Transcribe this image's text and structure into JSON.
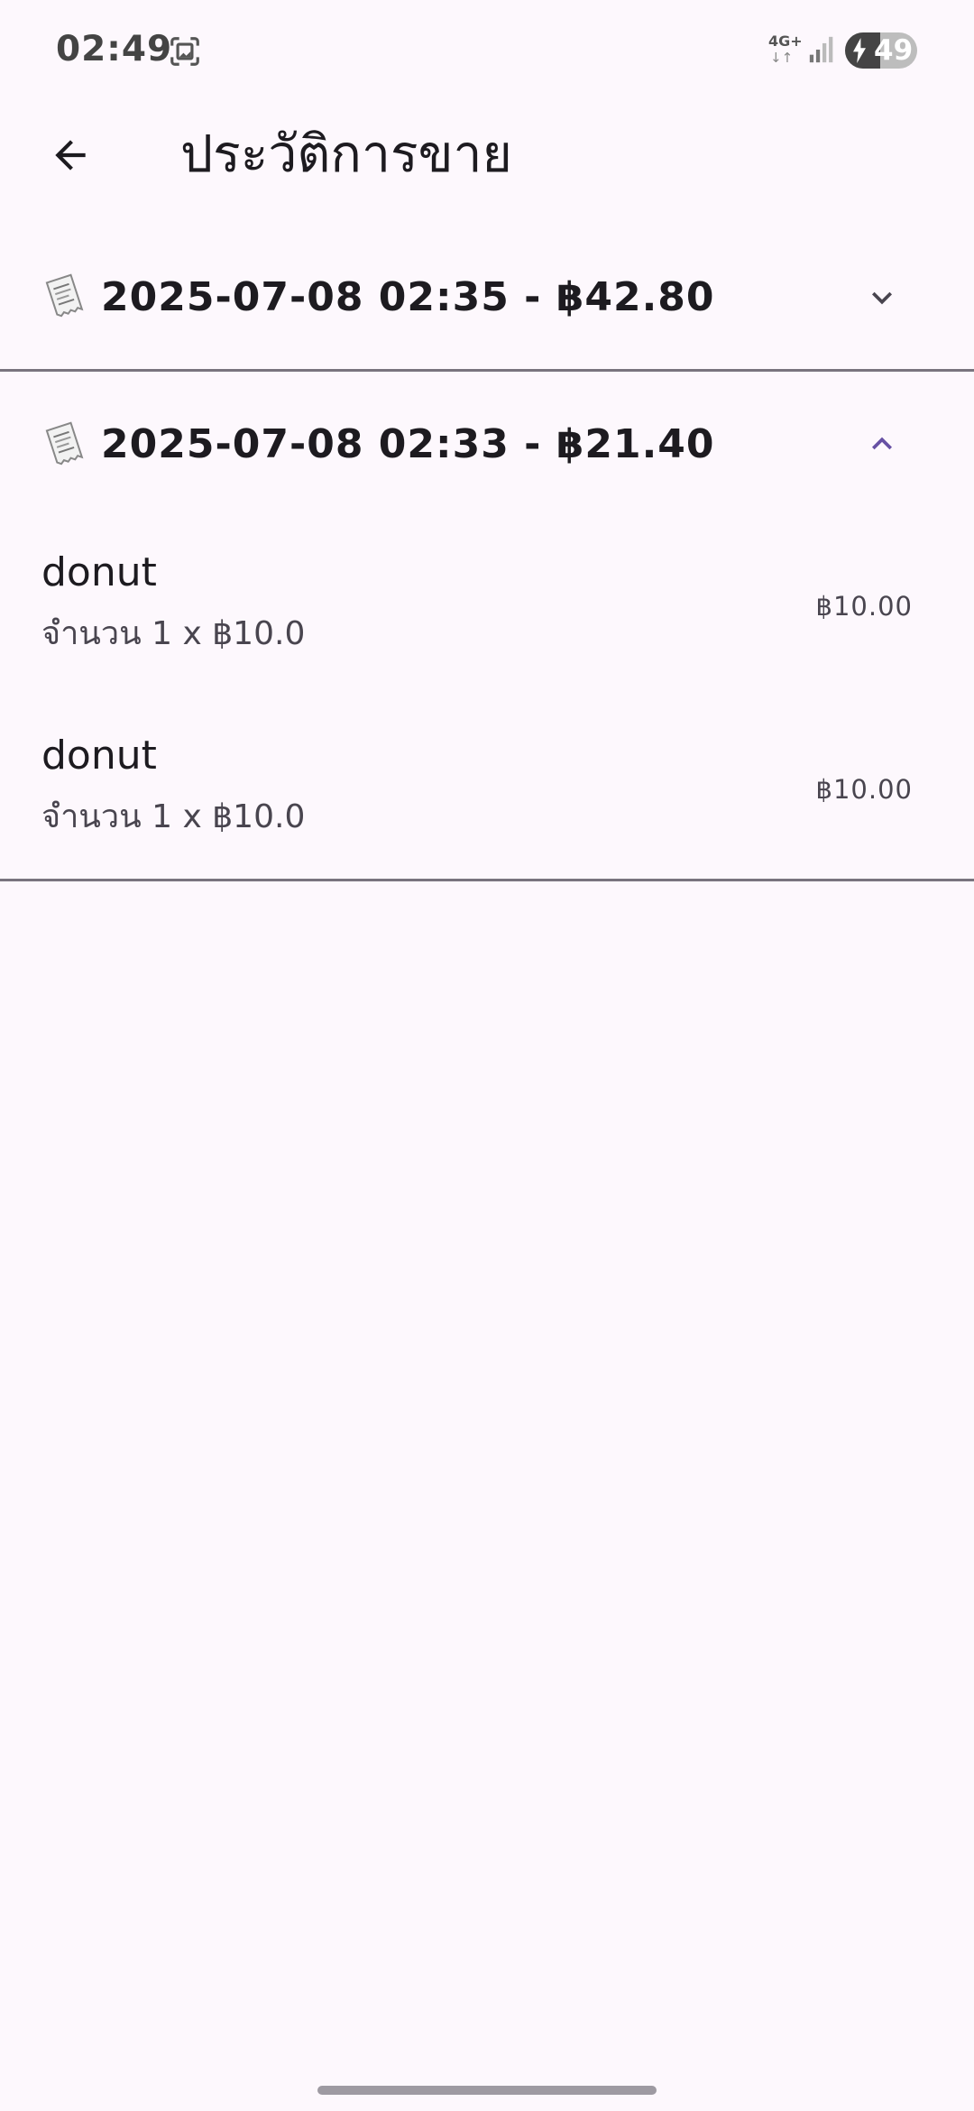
{
  "status_bar": {
    "time": "02:49",
    "network": "4G+",
    "network_arrows": "↓↑",
    "battery_level": 49,
    "battery_text": "49",
    "charging": true
  },
  "app_bar": {
    "back_icon": "arrow-back-icon",
    "title": "ประวัติการขาย"
  },
  "sales": [
    {
      "title": "2025-07-08 02:35 - ฿42.80",
      "icon": "receipt-icon",
      "expanded": false,
      "chevron_icon": "chevron-down-icon"
    },
    {
      "title": "2025-07-08 02:33 - ฿21.40",
      "icon": "receipt-icon",
      "expanded": true,
      "chevron_icon": "chevron-up-icon",
      "items": [
        {
          "name": "donut",
          "detail": "จำนวน 1 x ฿10.0",
          "price": "฿10.00"
        },
        {
          "name": "donut",
          "detail": "จำนวน 1 x ฿10.0",
          "price": "฿10.00"
        }
      ]
    }
  ],
  "colors": {
    "background": "#fdf8fd",
    "accent": "#6750a4",
    "divider": "#79747e",
    "text_primary": "#1d1b20",
    "text_secondary": "#49454f"
  }
}
